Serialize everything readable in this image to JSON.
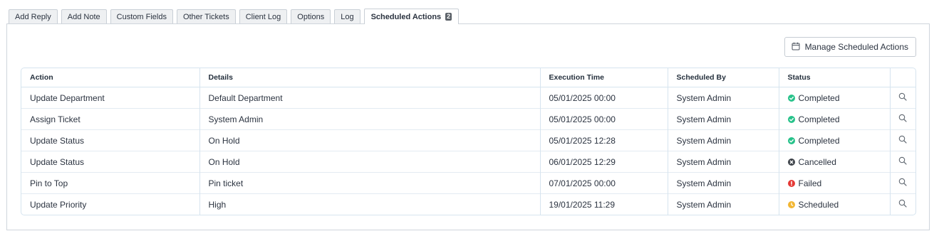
{
  "tabs": [
    {
      "label": "Add Reply"
    },
    {
      "label": "Add Note"
    },
    {
      "label": "Custom Fields"
    },
    {
      "label": "Other Tickets"
    },
    {
      "label": "Client Log"
    },
    {
      "label": "Options"
    },
    {
      "label": "Log"
    },
    {
      "label": "Scheduled Actions",
      "badge": "2",
      "active": true
    }
  ],
  "toolbar": {
    "manage_label": "Manage Scheduled Actions",
    "manage_icon": "calendar-icon"
  },
  "table": {
    "headers": {
      "action": "Action",
      "details": "Details",
      "execution_time": "Execution Time",
      "scheduled_by": "Scheduled By",
      "status": "Status"
    },
    "rows": [
      {
        "action": "Update Department",
        "details": "Default Department",
        "time": "05/01/2025 00:00",
        "by": "System Admin",
        "status": "Completed",
        "status_type": "completed"
      },
      {
        "action": "Assign Ticket",
        "details": "System Admin",
        "time": "05/01/2025 00:00",
        "by": "System Admin",
        "status": "Completed",
        "status_type": "completed"
      },
      {
        "action": "Update Status",
        "details": "On Hold",
        "time": "05/01/2025 12:28",
        "by": "System Admin",
        "status": "Completed",
        "status_type": "completed"
      },
      {
        "action": "Update Status",
        "details": "On Hold",
        "time": "06/01/2025 12:29",
        "by": "System Admin",
        "status": "Cancelled",
        "status_type": "cancelled"
      },
      {
        "action": "Pin to Top",
        "details": "Pin ticket",
        "time": "07/01/2025 00:00",
        "by": "System Admin",
        "status": "Failed",
        "status_type": "failed"
      },
      {
        "action": "Update Priority",
        "details": "High",
        "time": "19/01/2025 11:29",
        "by": "System Admin",
        "status": "Scheduled",
        "status_type": "scheduled"
      }
    ]
  },
  "colors": {
    "completed": "#27c28a",
    "cancelled": "#3d4249",
    "failed": "#e53935",
    "scheduled": "#f2b632"
  }
}
